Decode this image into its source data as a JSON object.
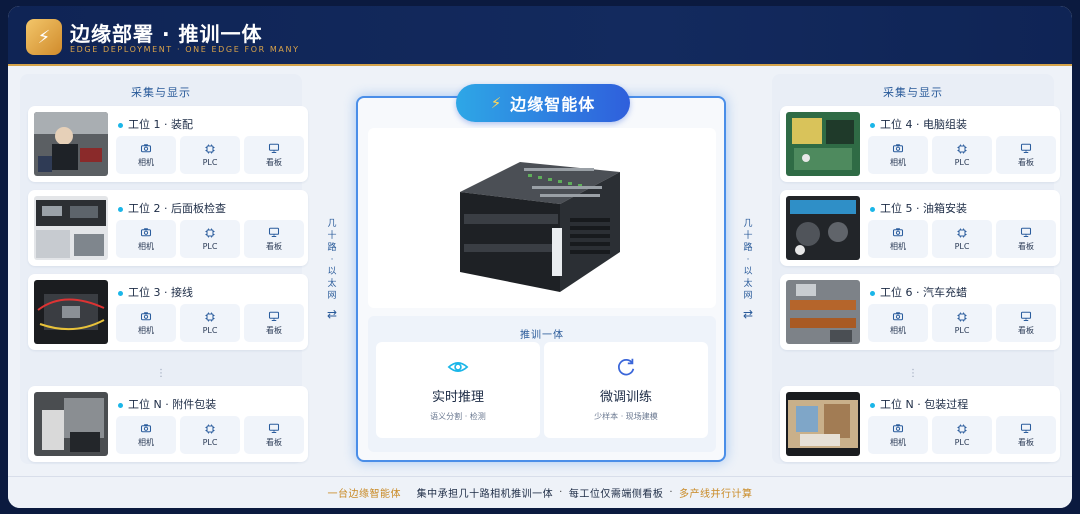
{
  "header": {
    "title": "边缘部署 · 推训一体",
    "subtitle": "EDGE DEPLOYMENT · ONE EDGE FOR MANY",
    "logo_icon": "bolt-icon"
  },
  "left_panel": {
    "heading": "采集与显示",
    "stations": [
      {
        "name": "工位 1 · 装配"
      },
      {
        "name": "工位 2 · 后面板检查"
      },
      {
        "name": "工位 3 · 接线"
      },
      {
        "name": "工位 N · 附件包装"
      }
    ]
  },
  "right_panel": {
    "heading": "采集与显示",
    "stations": [
      {
        "name": "工位 4 · 电脑组装"
      },
      {
        "name": "工位 5 · 油箱安装"
      },
      {
        "name": "工位 6 · 汽车充蜡"
      },
      {
        "name": "工位 N · 包装过程"
      }
    ]
  },
  "chips": {
    "camera": "相机",
    "plc": "PLC",
    "board": "看板"
  },
  "ellipsis": "⋮",
  "connector": {
    "chars": [
      "几",
      "十",
      "路",
      "·",
      "以",
      "太",
      "网"
    ],
    "arrow": "⇄"
  },
  "center": {
    "title": "边缘智能体",
    "title_icon": "bolt-icon",
    "section_title": "推训一体",
    "cards": [
      {
        "title": "实时推理",
        "desc": "语义分割 · 检测",
        "icon": "eye-icon"
      },
      {
        "title": "微调训练",
        "desc": "少样本 · 现场建模",
        "icon": "refresh-icon"
      }
    ]
  },
  "footer": {
    "part1": "一台边缘智能体",
    "part2": "集中承担几十路相机推训一体",
    "part3": "每工位仅需端侧看板",
    "part4": "多产线并行计算",
    "sep": "·"
  },
  "colors": {
    "header_bg": "#0f2455",
    "accent_gold": "#d4a34a",
    "accent_blue": "#2f5fdc",
    "dot_cyan": "#1bb6e8"
  }
}
